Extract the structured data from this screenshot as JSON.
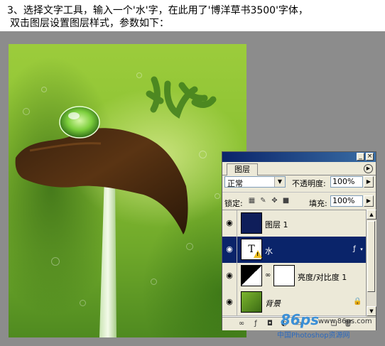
{
  "instructions": {
    "line1": "3、选择文字工具，输入一个'水'字，在此用了'博洋草书3500'字体，",
    "line2": "双击图层设置图层样式，参数如下："
  },
  "artwork": {
    "calligraphy_text": "水"
  },
  "layers_panel": {
    "tab_label": "图层",
    "blend_mode": "正常",
    "opacity_label": "不透明度:",
    "opacity_value": "100%",
    "lock_label": "锁定:",
    "fill_label": "填充:",
    "fill_value": "100%",
    "layers": [
      {
        "name": "图层 1",
        "selected": false
      },
      {
        "name": "水",
        "selected": true,
        "thumb_letter": "T",
        "warning": "!"
      },
      {
        "name": "亮度/对比度 1",
        "selected": false
      },
      {
        "name": "背景",
        "selected": false
      }
    ]
  },
  "watermark": {
    "logo": "86ps",
    "url": "www.86ps.com",
    "caption": "中国Photoshop资源网"
  },
  "colors": {
    "titlebar": "#0a246a",
    "selected_row": "#0a246a",
    "panel_bg": "#ece9d8",
    "canvas_bg": "#8c8c8c"
  }
}
